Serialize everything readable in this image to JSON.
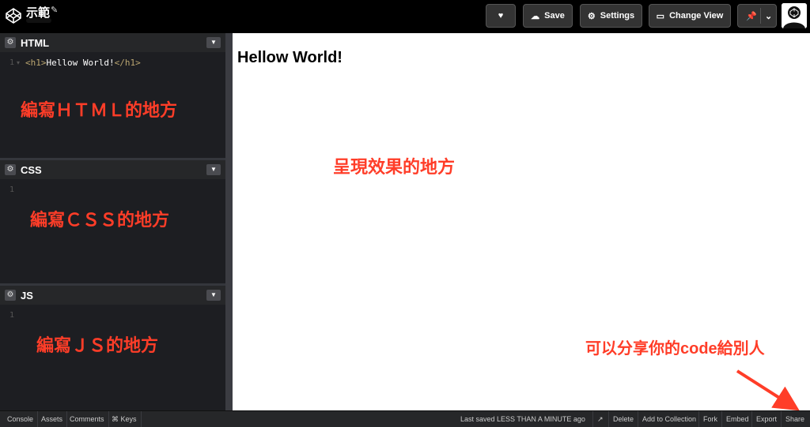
{
  "header": {
    "title": "示範",
    "buttons": {
      "save": "Save",
      "settings": "Settings",
      "change_view": "Change View"
    }
  },
  "editors": [
    {
      "name": "HTML",
      "line_numbers": [
        "1"
      ],
      "code": {
        "open_tag": "<h1>",
        "text": "Hellow World!",
        "close_tag": "</h1>"
      },
      "annotation": "編寫ＨＴＭＬ的地方"
    },
    {
      "name": "CSS",
      "line_numbers": [
        "1"
      ],
      "annotation": "編寫ＣＳＳ的地方"
    },
    {
      "name": "JS",
      "line_numbers": [
        "1"
      ],
      "annotation": "編寫ＪＳ的地方"
    }
  ],
  "preview": {
    "heading": "Hellow World!",
    "annotation": "呈現效果的地方",
    "share_annotation": "可以分享你的code給別人"
  },
  "footer": {
    "left": [
      "Console",
      "Assets",
      "Comments",
      "⌘ Keys"
    ],
    "saved_label": "Last saved",
    "saved_value": "LESS THAN A MINUTE ago",
    "right": [
      "Delete",
      "Add to Collection",
      "Fork",
      "Embed",
      "Export",
      "Share"
    ]
  },
  "colors": {
    "annotation": "#ff3d28",
    "accent_tag": "#bba671"
  }
}
